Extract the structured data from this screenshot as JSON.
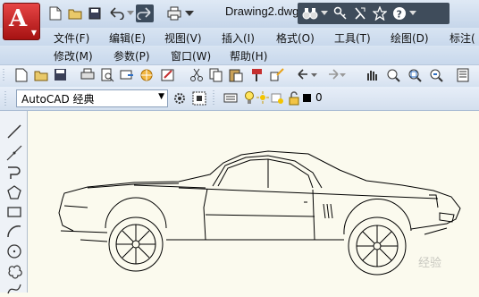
{
  "app": {
    "document_title": "Drawing2.dwg",
    "logo_letter": "A"
  },
  "menu_row1": [
    "文件(F)",
    "编辑(E)",
    "视图(V)",
    "插入(I)",
    "格式(O)",
    "工具(T)",
    "绘图(D)",
    "标注("
  ],
  "menu_row2": [
    "修改(M)",
    "参数(P)",
    "窗口(W)",
    "帮助(H)"
  ],
  "workspace": {
    "selected": "AutoCAD 经典"
  },
  "layer": {
    "current": "0"
  },
  "watermark": "经验",
  "colors": {
    "title_bg": "#c6d6ea",
    "logo_red": "#c41e1e",
    "canvas_bg": "#fbfaee"
  }
}
